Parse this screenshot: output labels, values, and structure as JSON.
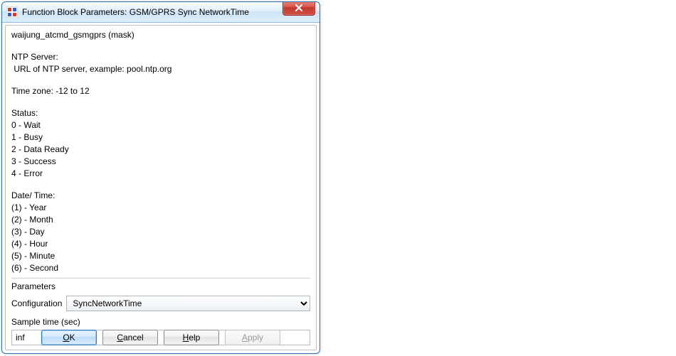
{
  "window": {
    "title": "Function Block Parameters: GSM/GPRS Sync NetworkTime"
  },
  "description": {
    "mask_header": "waijung_atcmd_gsmgprs (mask)",
    "ntp_header": "NTP Server:",
    "ntp_line": " URL of NTP server, example: pool.ntp.org",
    "tz_line": "Time zone: -12 to 12",
    "status_header": "Status:",
    "status_0": "0 - Wait",
    "status_1": "1 - Busy",
    "status_2": "2 - Data Ready",
    "status_3": "3 - Success",
    "status_4": "4 - Error",
    "dt_header": "Date/ Time:",
    "dt_1": "(1) - Year",
    "dt_2": "(2) - Month",
    "dt_3": "(3) - Day",
    "dt_4": "(4) - Hour",
    "dt_5": "(5) - Minute",
    "dt_6": "(6) - Second"
  },
  "params": {
    "section_label": "Parameters",
    "config_label": "Configuration",
    "config_value": "SyncNetworkTime",
    "sample_label": "Sample time (sec)",
    "sample_value": "inf"
  },
  "buttons": {
    "ok_u": "O",
    "ok_rest": "K",
    "cancel_u": "C",
    "cancel_rest": "ancel",
    "help_u": "H",
    "help_rest": "elp",
    "apply_u": "A",
    "apply_rest": "pply"
  }
}
